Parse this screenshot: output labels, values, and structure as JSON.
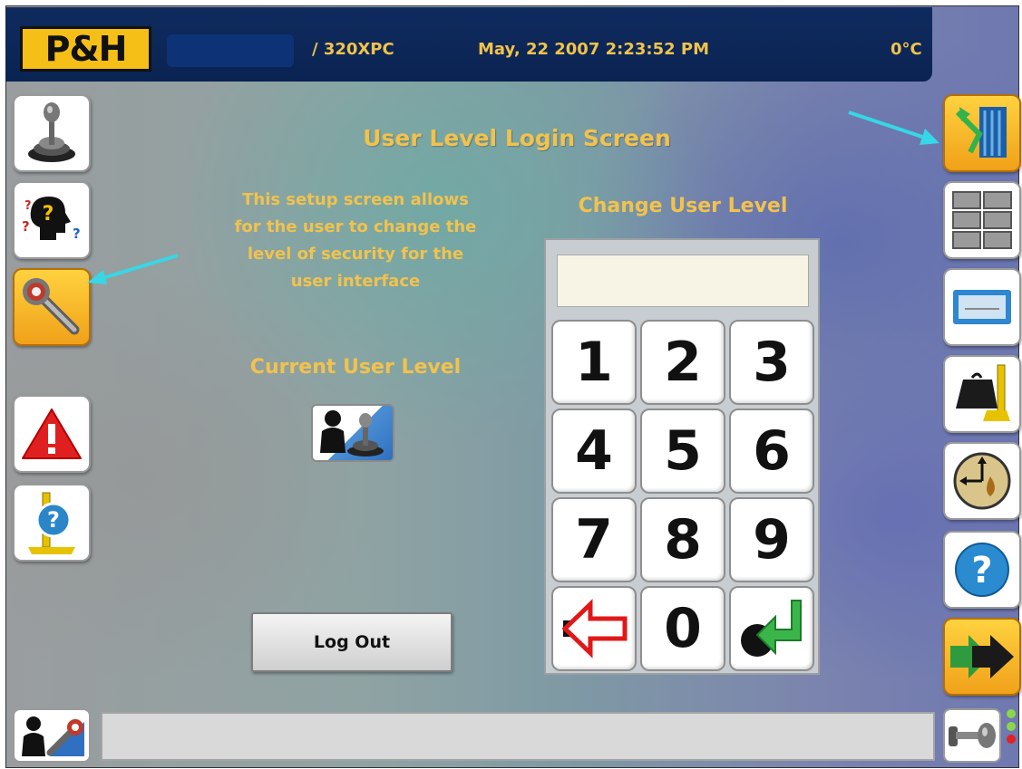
{
  "header": {
    "logo": "P&H",
    "model": "/ 320XPC",
    "datetime": "May, 22 2007 2:23:52 PM",
    "temperature": "0°C"
  },
  "main": {
    "title": "User Level Login Screen",
    "description_lines": [
      "This setup screen allows",
      "for the user to change the",
      "level of security for the",
      "user interface"
    ],
    "current_user_level_label": "Current User Level",
    "change_user_level_label": "Change User Level",
    "pin_value": "",
    "logout_label": "Log Out"
  },
  "keypad": {
    "keys": [
      "1",
      "2",
      "3",
      "4",
      "5",
      "6",
      "7",
      "8",
      "9",
      "back",
      "0",
      "enter"
    ]
  },
  "left_toolbar": [
    "joystick-icon",
    "help-mind-icon",
    "wrench-icon",
    "alarm-icon",
    "ruler-help-icon"
  ],
  "right_toolbar": [
    "crane-operation-icon",
    "grid-view-icon",
    "display-panel-icon",
    "load-weight-icon",
    "tilt-gauge-icon",
    "help-icon",
    "next-arrow-icon"
  ],
  "colors": {
    "header_bg": "#0a2352",
    "title_text": "#f2c24d",
    "logo_bg": "#f5bf17",
    "active_tile": "#f0a11a",
    "annotation_arrow": "#37d7e6"
  },
  "status_lights": [
    "green",
    "green",
    "red"
  ]
}
